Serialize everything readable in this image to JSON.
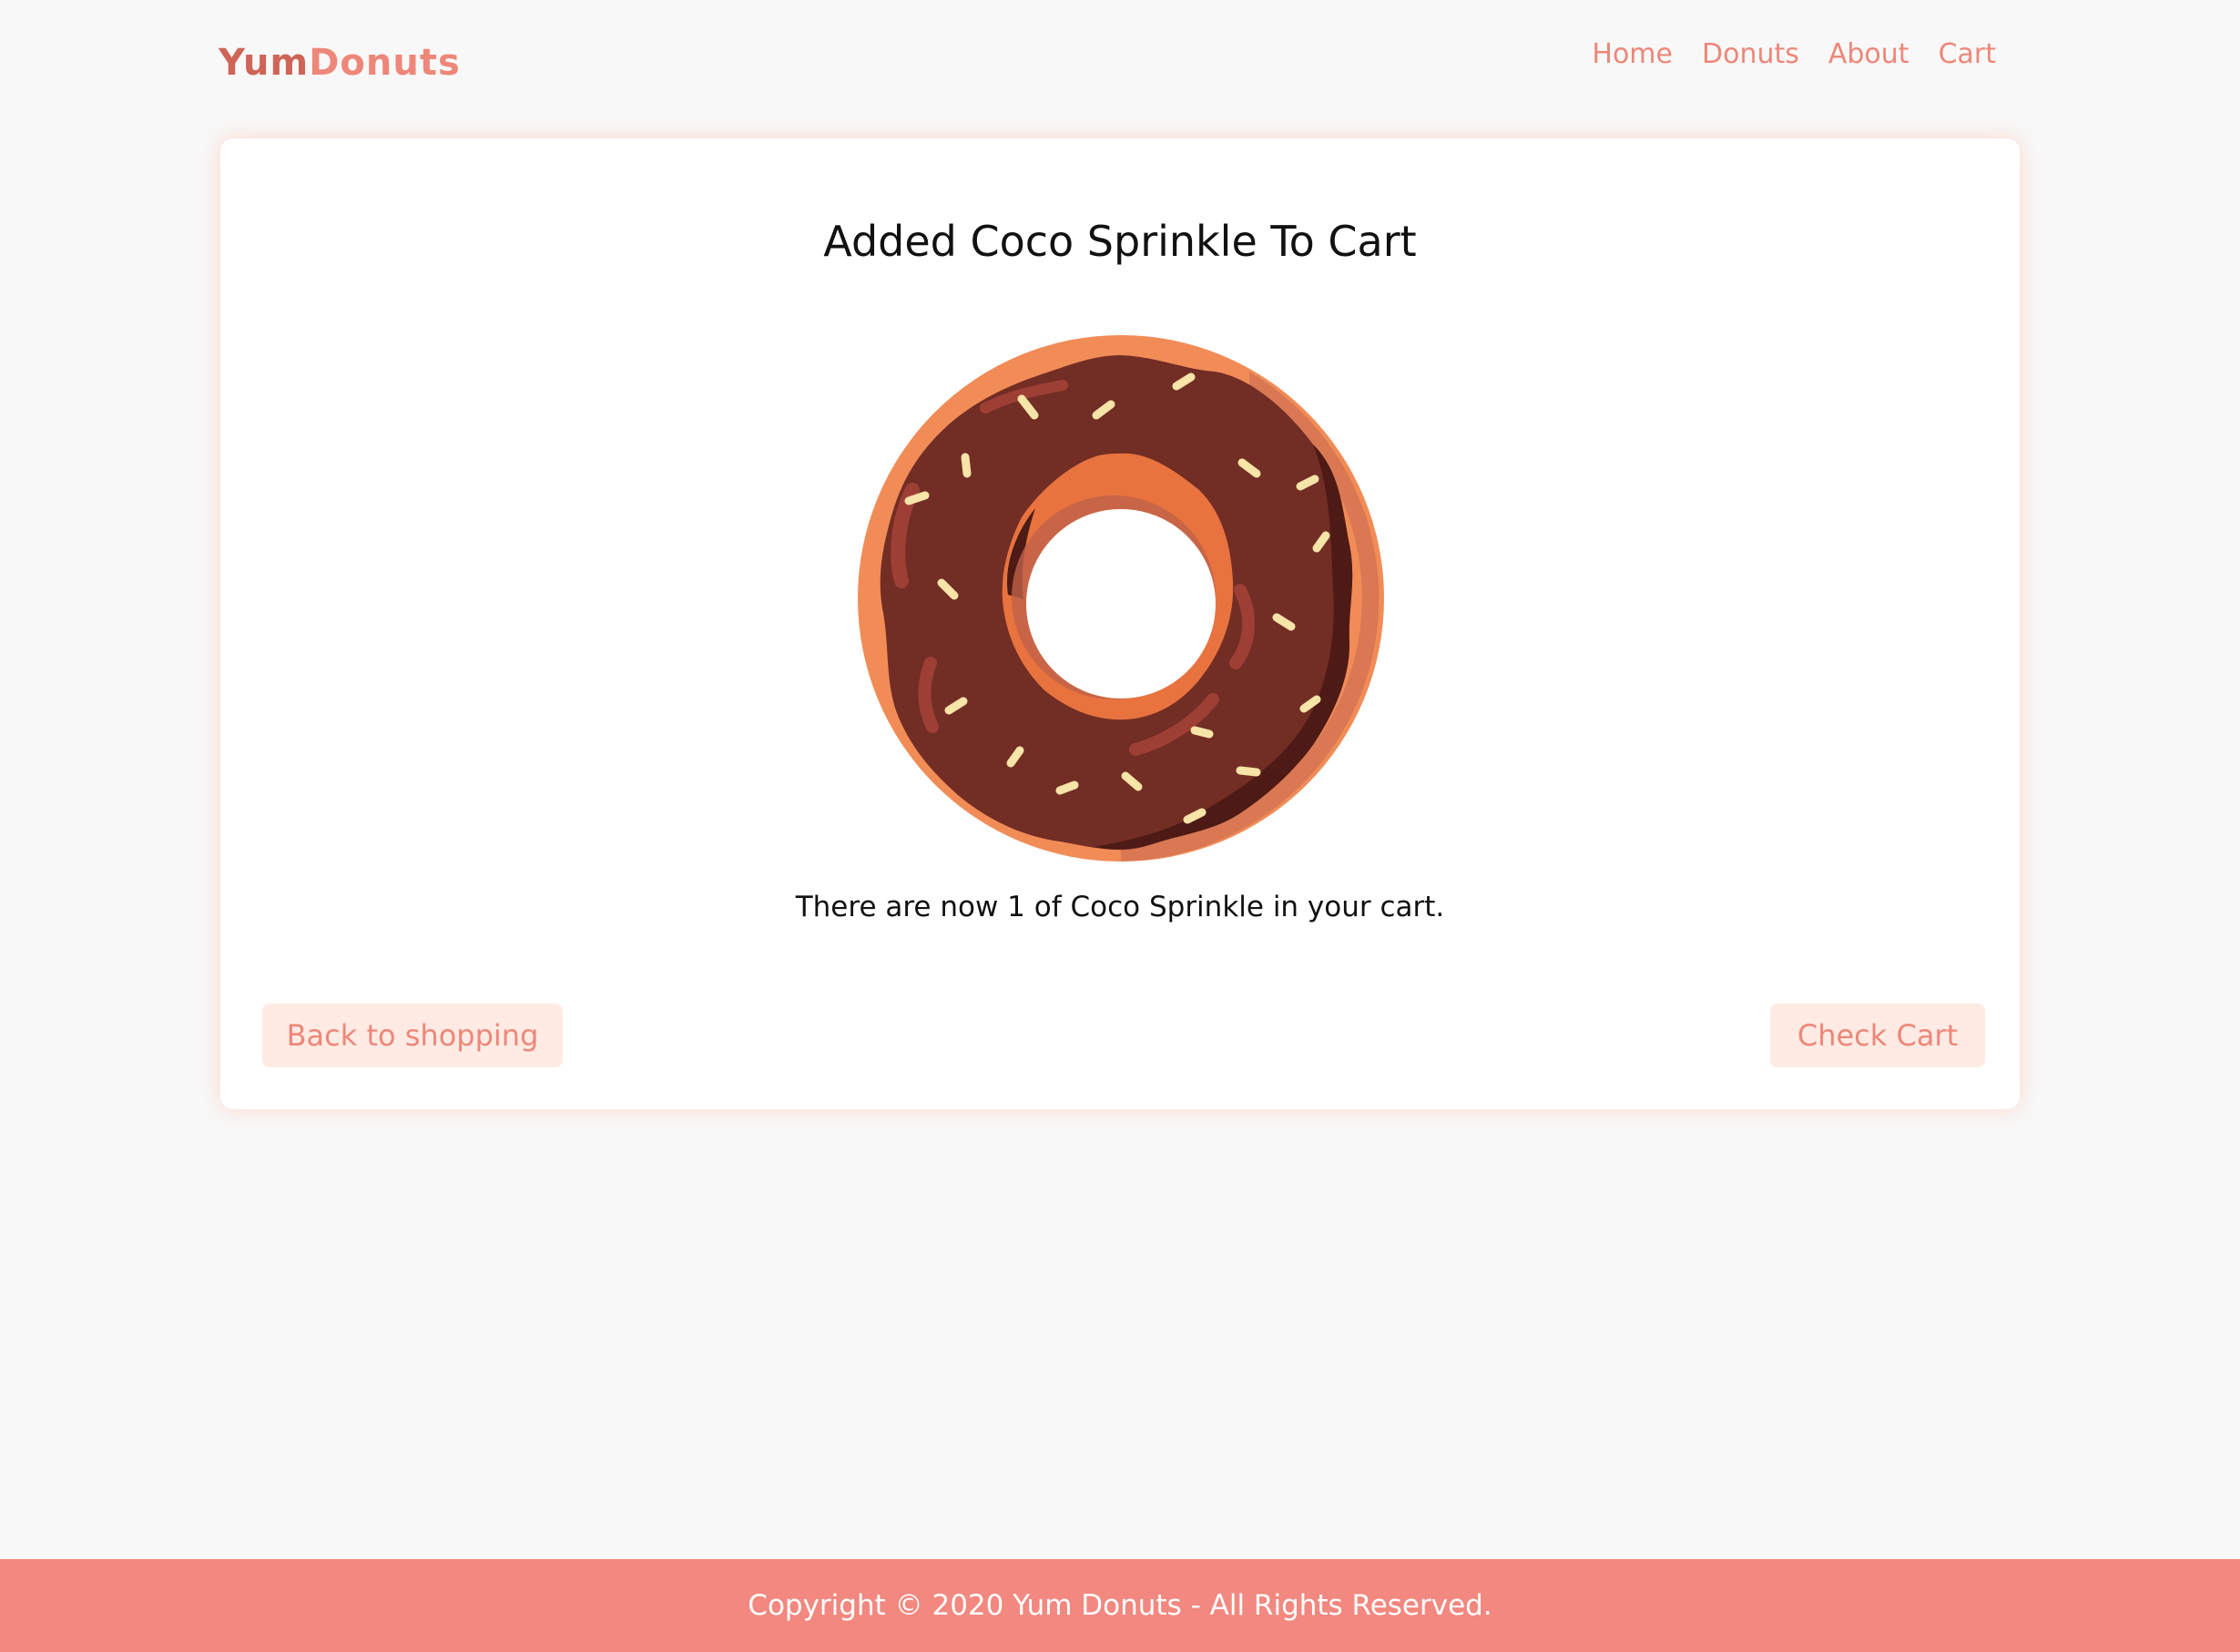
{
  "header": {
    "logo_part1": "Yum",
    "logo_part2": "Donuts",
    "nav": [
      {
        "label": "Home"
      },
      {
        "label": "Donuts"
      },
      {
        "label": "About"
      },
      {
        "label": "Cart"
      }
    ]
  },
  "main": {
    "title": "Added Coco Sprinkle To Cart",
    "image_icon": "chocolate-sprinkle-donut",
    "message": "There are now 1 of Coco Sprinkle in your cart.",
    "back_button": "Back to shopping",
    "cart_button": "Check Cart"
  },
  "footer": {
    "copyright": "Copyright © 2020 Yum Donuts - All Rights Reserved."
  },
  "colors": {
    "accent": "#ee8779",
    "logo_dark": "#cf6557",
    "button_bg": "#ffebe4",
    "footer_bg": "#f2887f",
    "page_bg": "#f8f8f8"
  }
}
